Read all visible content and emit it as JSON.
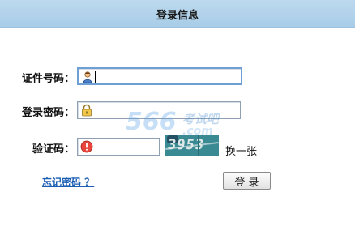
{
  "header": {
    "title": "登录信息"
  },
  "form": {
    "id_label": "证件号码：",
    "id_value": "",
    "password_label": "登录密码：",
    "password_value": "",
    "captcha_label": "验证码：",
    "captcha_value": "",
    "captcha_code": "3953",
    "refresh_label": "换一张"
  },
  "links": {
    "forgot_password": "忘记密码 ？"
  },
  "buttons": {
    "login": "登 录"
  },
  "watermark": {
    "number": "566",
    "text": "考试吧",
    "domain": ".com"
  },
  "icons": {
    "id_field": "user-icon",
    "password_field": "lock-icon",
    "captcha_field": "warning-icon"
  },
  "colors": {
    "header_bg": "#b3d3eb",
    "link": "#1a5fb4",
    "captcha_bg": "#3a8a94"
  }
}
